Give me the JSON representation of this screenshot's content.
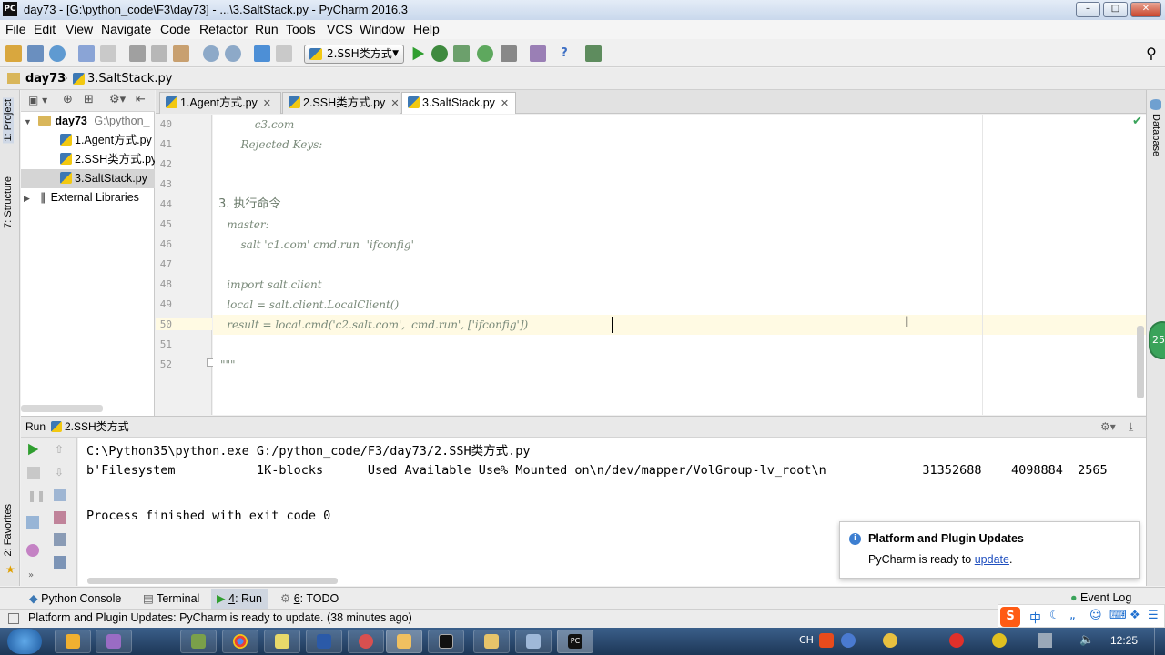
{
  "window": {
    "title": "day73 - [G:\\python_code\\F3\\day73] - ...\\3.SaltStack.py - PyCharm 2016.3",
    "app_icon": "PC"
  },
  "menu": [
    "File",
    "Edit",
    "View",
    "Navigate",
    "Code",
    "Refactor",
    "Run",
    "Tools",
    "VCS",
    "Window",
    "Help"
  ],
  "toolbar": {
    "run_config": "2.SSH类方式"
  },
  "breadcrumb": {
    "project": "day73",
    "file": "3.SaltStack.py"
  },
  "side_tabs": {
    "project": "1: Project",
    "structure": "7: Structure",
    "favorites": "2: Favorites",
    "database": "Database"
  },
  "project_tree": {
    "root": {
      "name": "day73",
      "path": "G:\\python_"
    },
    "files": [
      "1.Agent方式.py",
      "2.SSH类方式.py",
      "3.SaltStack.py"
    ],
    "external": "External Libraries"
  },
  "editor_tabs": [
    "1.Agent方式.py",
    "2.SSH类方式.py",
    "3.SaltStack.py"
  ],
  "editor": {
    "line_numbers": [
      "40",
      "41",
      "42",
      "43",
      "44",
      "45",
      "46",
      "47",
      "48",
      "49",
      "50",
      "51",
      "52"
    ],
    "lines": [
      "            c3.com",
      "        Rejected Keys:",
      "",
      "",
      "3. 执行命令",
      "    master:",
      "        salt 'c1.com' cmd.run  'ifconfig'",
      "",
      "    import salt.client",
      "    local = salt.client.LocalClient()",
      "    result = local.cmd('c2.salt.com', 'cmd.run', ['ifconfig'])",
      "",
      "\"\"\""
    ]
  },
  "run_panel": {
    "label": "Run",
    "config": "2.SSH类方式",
    "output": [
      "C:\\Python35\\python.exe G:/python_code/F3/day73/2.SSH类方式.py",
      "b'Filesystem           1K-blocks      Used Available Use% Mounted on\\n/dev/mapper/VolGroup-lv_root\\n             31352688    4098884  2565",
      "",
      "Process finished with exit code 0"
    ]
  },
  "notification": {
    "title": "Platform and Plugin Updates",
    "text": "PyCharm is ready to ",
    "link": "update",
    "end": "."
  },
  "tool_windows": {
    "python_console": "Python Console",
    "terminal": "Terminal",
    "run_num": "4",
    "run": ": Run",
    "todo_num": "6",
    "todo": ": TODO",
    "event_log": "Event Log"
  },
  "status": {
    "message": "Platform and Plugin Updates: PyCharm is ready to update. (38 minutes ago)"
  },
  "taskbar": {
    "clock": "12:25",
    "ime": "CH",
    "badge": "25"
  }
}
